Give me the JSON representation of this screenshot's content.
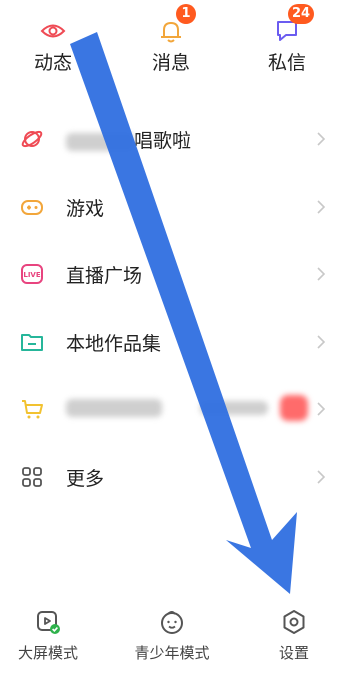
{
  "top_tabs": {
    "dynamic": {
      "label": "动态",
      "icon": "eye-icon"
    },
    "messages": {
      "label": "消息",
      "icon": "bell-icon",
      "badge": "1"
    },
    "dm": {
      "label": "私信",
      "icon": "chat-bubble-icon",
      "badge": "24"
    }
  },
  "menu": {
    "items": [
      {
        "label": "唱歌啦",
        "icon": "planet-icon",
        "color": "#ef4b55"
      },
      {
        "label": "游戏",
        "icon": "gamepad-icon",
        "color": "#f2a63b"
      },
      {
        "label": "直播广场",
        "icon": "live-icon",
        "color": "#e8447f",
        "icon_text": "LIVE"
      },
      {
        "label": "本地作品集",
        "icon": "folder-icon",
        "color": "#26b69a"
      },
      {
        "label": "",
        "icon": "cart-icon",
        "color": "#f2c230"
      },
      {
        "label": "更多",
        "icon": "grid-icon",
        "color": "#555555"
      }
    ]
  },
  "bottom_bar": {
    "big_screen": {
      "label": "大屏模式",
      "icon": "big-screen-icon"
    },
    "teen_mode": {
      "label": "青少年模式",
      "icon": "teen-face-icon"
    },
    "settings": {
      "label": "设置",
      "icon": "settings-hexagon-icon"
    }
  },
  "colors": {
    "arrow": "#2f6fe0",
    "badge": "#ff5a1f"
  }
}
